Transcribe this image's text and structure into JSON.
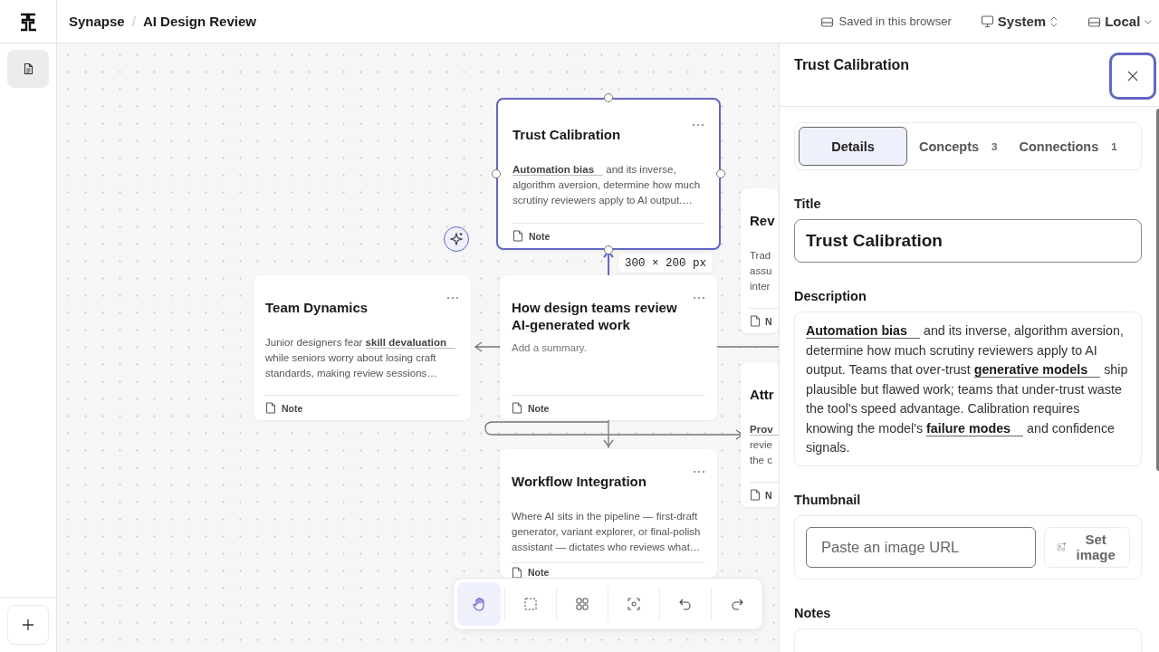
{
  "app": {
    "name": "Synapse",
    "separator": "/",
    "document": "AI Design Review"
  },
  "header_status": [
    {
      "kind": "saved",
      "label": "Saved in this browser"
    },
    {
      "kind": "theme",
      "label": "System"
    },
    {
      "kind": "storage",
      "label": "Local"
    }
  ],
  "rail": {
    "items": [
      {
        "kind": "document",
        "selected": true
      }
    ]
  },
  "canvas": {
    "cards": [
      {
        "title": "Trust Calibration",
        "summary": "**Automation bias** and its inverse, algorithm aversion, determine how much scrutiny reviewers apply to AI output.…",
        "footer": "Note",
        "selected": true
      },
      {
        "title": "Team Dynamics",
        "summary": "Junior designers fear **skill devaluation** while seniors worry about losing craft standards, making review sessions…",
        "footer": "Note",
        "selected": false
      },
      {
        "title": "How design teams review AI-generated work",
        "placeholder": "Add a summary.",
        "footer": "Note",
        "selected": false
      },
      {
        "title": "Rev",
        "lines": [
          "Trad",
          "assu",
          "inter"
        ],
        "footer": "N",
        "selected": false
      },
      {
        "title": "Attr",
        "lines": [
          "**Prov**",
          "revie",
          "the c"
        ],
        "footer": "N",
        "selected": false
      },
      {
        "title": "Workflow Integration",
        "summary": "Where AI sits in the pipeline — first-draft generator, variant explorer, or final-polish assistant — dictates who reviews what…",
        "footer": "Note",
        "selected": false
      }
    ],
    "size_tooltip": "300 × 200 px",
    "toolbar": [
      {
        "kind": "pan",
        "selected": true
      },
      {
        "kind": "select",
        "selected": false
      },
      {
        "kind": "grid",
        "selected": false
      },
      {
        "kind": "focus",
        "selected": false
      },
      {
        "kind": "undo",
        "selected": false
      },
      {
        "kind": "redo",
        "selected": false
      }
    ]
  },
  "panel": {
    "title": "Trust Calibration",
    "tabs": [
      {
        "label": "Details",
        "selected": true
      },
      {
        "label": "Concepts",
        "count": "3",
        "selected": false
      },
      {
        "label": "Connections",
        "count": "1",
        "selected": false
      }
    ],
    "fields": [
      {
        "kind": "text",
        "label": "Title",
        "value": "Trust Calibration"
      },
      {
        "kind": "rich",
        "label": "Description",
        "value": "**Automation bias** and its inverse, algorithm aversion, determine how much scrutiny reviewers apply to AI output. Teams that over-trust **generative models** ship plausible but flawed work; teams that under-trust waste the tool's speed advantage. Calibration requires knowing the model's **failure modes** and confidence signals."
      },
      {
        "kind": "image",
        "label": "Thumbnail",
        "placeholder": "Paste an image URL",
        "button": "Set image"
      },
      {
        "kind": "notes",
        "label": "Notes"
      }
    ]
  }
}
